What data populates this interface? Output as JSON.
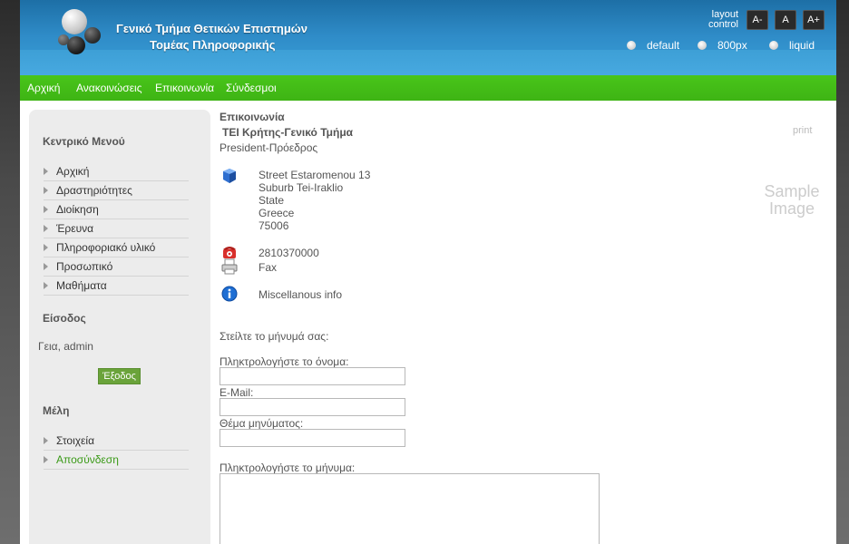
{
  "header": {
    "title": "Γενικό Τμήμα Θετικών Επιστημών",
    "subtitle": "Τομέας Πληροφορικής",
    "layout_label_1": "layout",
    "layout_label_2": "control",
    "font_buttons": [
      "A-",
      "A",
      "A+"
    ],
    "width_options": [
      "default",
      "800px",
      "liquid"
    ]
  },
  "nav": {
    "items": [
      "Αρχική",
      "Ανακοινώσεις",
      "Επικοινωνία",
      "Σύνδεσμοι"
    ]
  },
  "sidebar": {
    "main_menu_title": "Κεντρικό Μενού",
    "main_menu": [
      "Αρχική",
      "Δραστηριότητες",
      "Διοίκηση",
      "Έρευνα",
      "Πληροφοριακό υλικό",
      "Προσωπικό",
      "Μαθήματα"
    ],
    "login_title": "Είσοδος",
    "greeting": "Γεια, admin",
    "logout_label": "Έξοδος",
    "members_title": "Μέλη",
    "members_menu": [
      "Στοιχεία",
      "Αποσύνδεση"
    ]
  },
  "main": {
    "page_title": "Επικοινωνία",
    "contact_name": "ΤΕΙ Κρήτης-Γενικό Τμήμα",
    "contact_position": "President-Πρόεδρος",
    "print_label": "print",
    "address": [
      "Street Estaromenou 13",
      "Suburb Tei-Iraklio",
      "State",
      "Greece",
      "75006"
    ],
    "phone": "2810370000",
    "fax": "Fax",
    "misc": "Miscellanous info",
    "sample_image": "Sample Image",
    "form": {
      "intro": "Στείλτε το μήνυμά σας:",
      "name_label": "Πληκτρολογήστε το όνομα:",
      "email_label": "E-Mail:",
      "subject_label": "Θέμα μηνύματος:",
      "message_label": "Πληκτρολογήστε το μήνυμα:"
    }
  },
  "colors": {
    "header_blue": "#2f8cc8",
    "nav_green": "#45bf18",
    "logout_green": "#6aa33a",
    "active_link_green": "#3a9a17"
  }
}
